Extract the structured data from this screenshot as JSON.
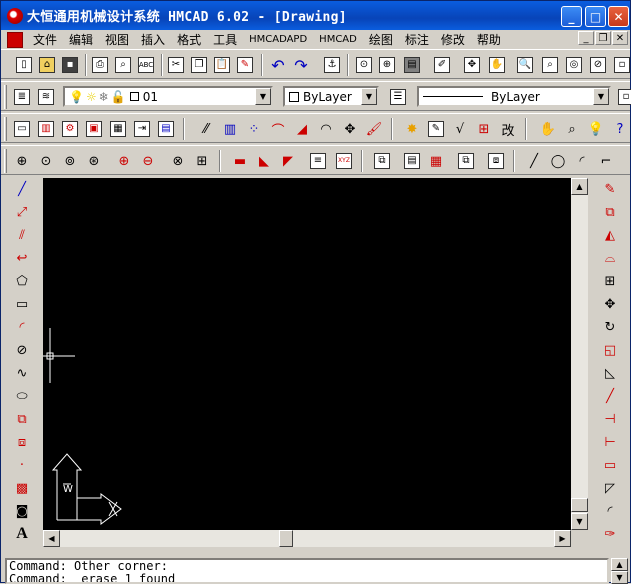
{
  "window": {
    "title": "大恒通用机械设计系统 HMCAD 6.02 - [Drawing]",
    "caption_buttons": [
      "minimize",
      "maximize",
      "close"
    ]
  },
  "menubar": {
    "items": [
      "文件",
      "编辑",
      "视图",
      "插入",
      "格式",
      "工具",
      "HMCADAPD",
      "HMCAD",
      "绘图",
      "标注",
      "修改",
      "帮助"
    ]
  },
  "layer_bar": {
    "layer_name": "01",
    "color_value": "ByLayer",
    "linetype_value": "ByLayer"
  },
  "toolbars": {
    "standard": [
      "new-icon",
      "open-icon",
      "save-icon",
      "print-icon",
      "preview-icon",
      "spell-icon",
      "cut-icon",
      "copy-icon",
      "paste-icon",
      "match-icon",
      "undo-icon",
      "redo-icon",
      "hyperlink-icon",
      "osnap-icon",
      "tracking-icon",
      "ucs-icon",
      "properties-icon",
      "designcenter-icon",
      "pan-icon",
      "zoom-realtime-icon",
      "zoom-window-icon",
      "zoom-previous-icon"
    ],
    "icon_colors": {
      "cyan": "#008080",
      "red": "#c00000",
      "blue": "#0000c0",
      "yellow": "#e8d000",
      "green": "#008000"
    }
  },
  "command_window": {
    "lines": [
      "Command: Other corner:",
      "Command: _erase 1 found"
    ]
  },
  "canvas": {
    "background": "#000000",
    "ucs_labels": {
      "w": "W"
    }
  }
}
